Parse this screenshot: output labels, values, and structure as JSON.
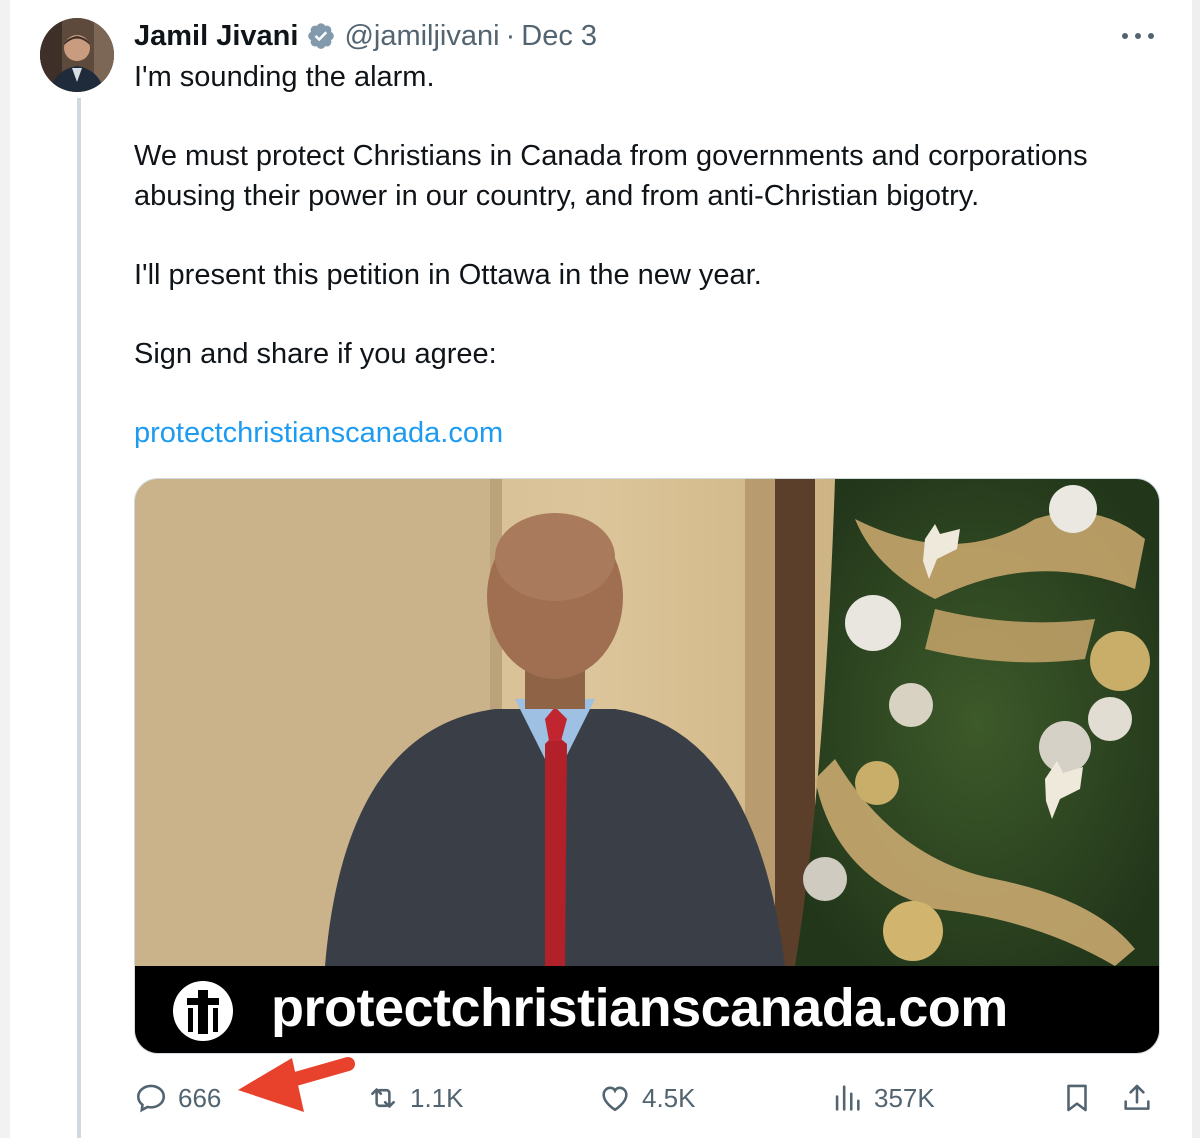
{
  "tweet": {
    "author": {
      "display_name": "Jamil Jivani",
      "handle": "@jamiljivani",
      "separator": "·",
      "date": "Dec 3",
      "verified": true
    },
    "text": {
      "line1": "I'm sounding the alarm.",
      "para2": "We must protect Christians in Canada from governments and corporations abusing their power in our country, and from anti-Christian bigotry.",
      "para3": "I'll present this petition in Ottawa in the new year.",
      "para4": "Sign and share if you agree:",
      "link": "protectchristianscanada.com"
    },
    "media": {
      "type": "video-thumbnail",
      "banner_text": "protectchristianscanada.com",
      "banner_logo": "cross-shield-logo"
    },
    "actions": {
      "reply_count": "666",
      "retweet_count": "1.1K",
      "like_count": "4.5K",
      "view_count": "357K"
    }
  },
  "icons": {
    "more": "more-horizontal-icon",
    "reply": "reply-bubble-icon",
    "retweet": "retweet-icon",
    "like": "heart-icon",
    "views": "views-bar-icon",
    "bookmark": "bookmark-icon",
    "share": "share-icon",
    "verified": "verified-badge-icon"
  },
  "colors": {
    "text": "#0f1419",
    "muted": "#536471",
    "link": "#1d9bf0",
    "annotation_arrow": "#e8412c",
    "verified_badge": "#829aab"
  }
}
